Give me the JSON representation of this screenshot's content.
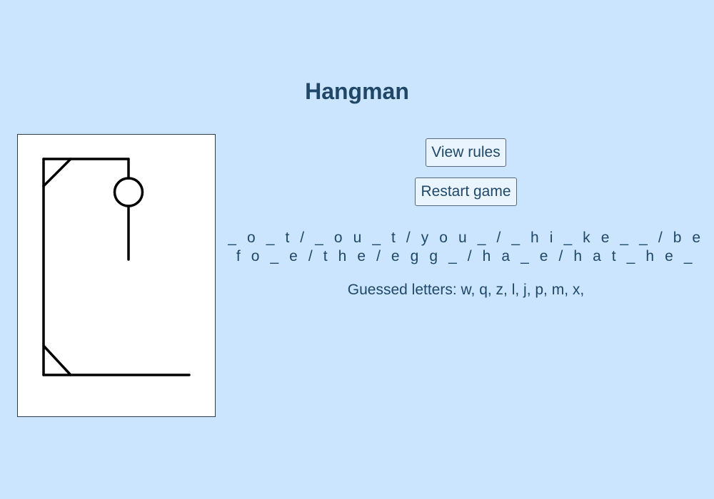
{
  "title": "Hangman",
  "buttons": {
    "view_rules": "View rules",
    "restart_game": "Restart game"
  },
  "word_display": "_ o _ t / _ o u _ t / y o u _ / _ h i _ k e _ _ / b e f o _ e / t h e / e g g _ / h a _ e / h a t _ h e _",
  "guessed": {
    "label": "Guessed letters:",
    "letters": [
      "w",
      "q",
      "z",
      "l",
      "j",
      "p",
      "m",
      "x"
    ]
  },
  "hangman": {
    "wrong_guesses": 8,
    "parts_drawn": [
      "base",
      "pole",
      "beam",
      "brace-top",
      "brace-bottom",
      "rope",
      "head",
      "body"
    ]
  },
  "colors": {
    "background": "#cce5ff",
    "text": "#1f4767",
    "canvas": "#ffffff",
    "stroke": "#000000"
  }
}
